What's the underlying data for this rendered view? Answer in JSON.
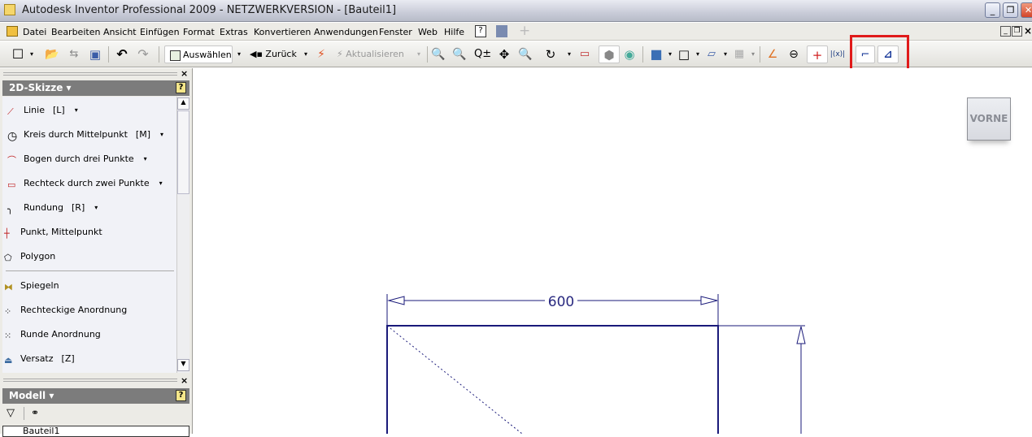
{
  "window": {
    "title": "Autodesk Inventor Professional 2009 - NETZWERKVERSION - [Bauteil1]",
    "minimize": "_",
    "restore": "❐",
    "close": "✕"
  },
  "menu": {
    "items": [
      "Datei",
      "Bearbeiten",
      "Ansicht",
      "Einfügen",
      "Format",
      "Extras",
      "Konvertieren",
      "Anwendungen",
      "Fenster",
      "Web",
      "Hilfe"
    ],
    "help_icon": "?"
  },
  "toolbar": {
    "select": "Auswählen",
    "back": "Zurück",
    "update": "Aktualisieren"
  },
  "sketch_panel": {
    "title": "2D-Skizze ▾",
    "help": "?",
    "items": [
      {
        "label": "Linie",
        "shortcut": "[L]",
        "dropdown": "▾"
      },
      {
        "label": "Kreis durch Mittelpunkt",
        "shortcut": "[M]",
        "dropdown": "▾"
      },
      {
        "label": "Bogen durch drei Punkte",
        "shortcut": "",
        "dropdown": "▾"
      },
      {
        "label": "Rechteck durch zwei Punkte",
        "shortcut": "",
        "dropdown": "▾"
      },
      {
        "label": "Rundung",
        "shortcut": "[R]",
        "dropdown": "▾"
      },
      {
        "label": "Punkt, Mittelpunkt",
        "shortcut": "",
        "dropdown": ""
      },
      {
        "label": "Polygon",
        "shortcut": "",
        "dropdown": ""
      },
      {
        "label": "Spiegeln",
        "shortcut": "",
        "dropdown": ""
      },
      {
        "label": "Rechteckige Anordnung",
        "shortcut": "",
        "dropdown": ""
      },
      {
        "label": "Runde Anordnung",
        "shortcut": "",
        "dropdown": ""
      },
      {
        "label": "Versatz",
        "shortcut": "[Z]",
        "dropdown": ""
      }
    ]
  },
  "model_panel": {
    "title": "Modell ▾",
    "help": "?",
    "tree_root": "Bauteil1"
  },
  "viewcube": {
    "label": "VORNE"
  },
  "drawing": {
    "dimension": "600",
    "line_color": "#1a1a7a"
  },
  "colors": {
    "highlight": "#e01a1a"
  }
}
